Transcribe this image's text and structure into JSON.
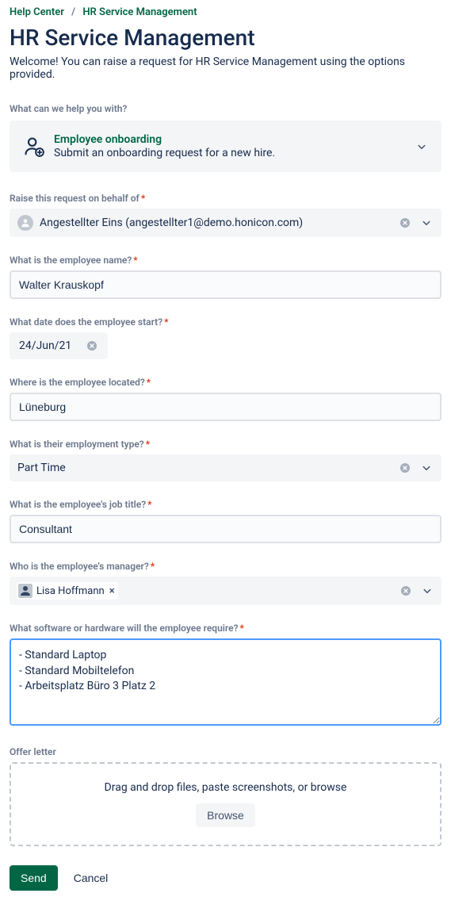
{
  "breadcrumb": {
    "help_center": "Help Center",
    "current": "HR Service Management"
  },
  "page": {
    "title": "HR Service Management",
    "welcome": "Welcome! You can raise a request for HR Service Management using the options provided."
  },
  "help_with_label": "What can we help you with?",
  "request_type": {
    "title": "Employee onboarding",
    "desc": "Submit an onboarding request for a new hire."
  },
  "fields": {
    "on_behalf": {
      "label": "Raise this request on behalf of",
      "value": "Angestellter Eins (angestellter1@demo.honicon.com)"
    },
    "employee_name": {
      "label": "What is the employee name?",
      "value": "Walter Krauskopf"
    },
    "start_date": {
      "label": "What date does the employee start?",
      "value": "24/Jun/21"
    },
    "location": {
      "label": "Where is the employee located?",
      "value": "Lüneburg"
    },
    "employment_type": {
      "label": "What is their employment type?",
      "value": "Part Time"
    },
    "job_title": {
      "label": "What is the employee's job title?",
      "value": "Consultant"
    },
    "manager": {
      "label": "Who is the employee's manager?",
      "value": "Lisa Hoffmann"
    },
    "requirements": {
      "label": "What software or hardware will the employee require?",
      "value": "- Standard Laptop\n- Standard Mobiltelefon\n- Arbeitsplatz Büro 3 Platz 2"
    },
    "offer_letter": {
      "label": "Offer letter",
      "dropzone_text": "Drag and drop files, paste screenshots, or browse",
      "browse": "Browse"
    }
  },
  "buttons": {
    "send": "Send",
    "cancel": "Cancel"
  }
}
